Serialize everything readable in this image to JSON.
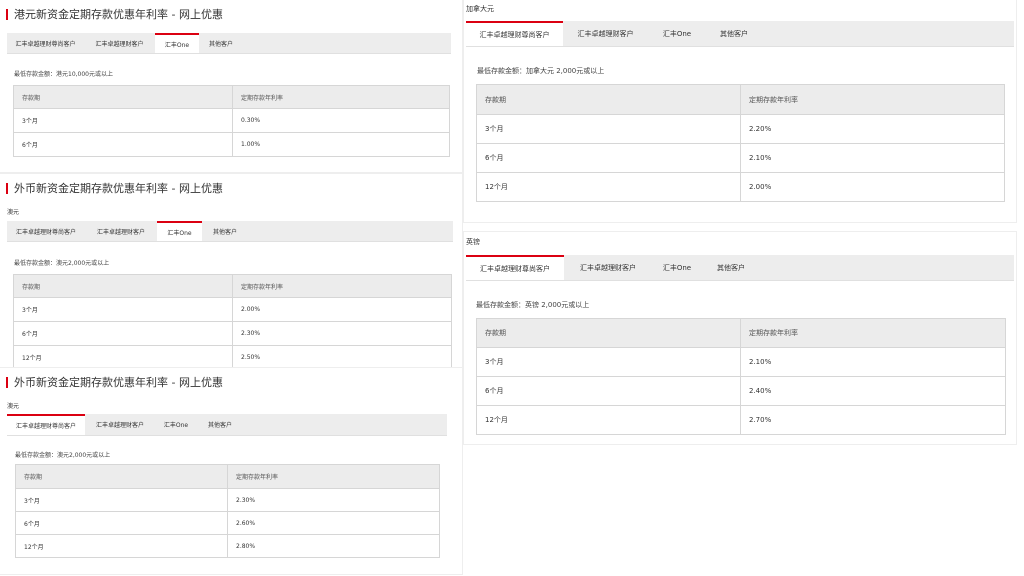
{
  "common": {
    "tabs": [
      "汇丰卓越理财尊尚客户",
      "汇丰卓越理财客户",
      "汇丰One",
      "其他客户"
    ],
    "col_period": "存款期",
    "col_rate": "定期存款年利率"
  },
  "hkd": {
    "title": "港元新资金定期存款优惠年利率 - 网上优惠",
    "min": "最低存款金额：港元10,000元或以上",
    "rows": [
      [
        "3个月",
        "0.30%"
      ],
      [
        "6个月",
        "1.00%"
      ]
    ]
  },
  "aud1": {
    "title": "外币新资金定期存款优惠年利率 - 网上优惠",
    "currency": "澳元",
    "min": "最低存款金额：澳元2,000元或以上",
    "rows": [
      [
        "3个月",
        "2.00%"
      ],
      [
        "6个月",
        "2.30%"
      ],
      [
        "12个月",
        "2.50%"
      ]
    ]
  },
  "aud2": {
    "title": "外币新资金定期存款优惠年利率 - 网上优惠",
    "currency": "澳元",
    "min": "最低存款金额：澳元2,000元或以上",
    "rows": [
      [
        "3个月",
        "2.30%"
      ],
      [
        "6个月",
        "2.60%"
      ],
      [
        "12个月",
        "2.80%"
      ]
    ]
  },
  "cad": {
    "currency": "加拿大元",
    "min": "最低存款金额：加拿大元 2,000元或以上",
    "rows": [
      [
        "3个月",
        "2.20%"
      ],
      [
        "6个月",
        "2.10%"
      ],
      [
        "12个月",
        "2.00%"
      ]
    ]
  },
  "gbp": {
    "currency": "英镑",
    "min": "最低存款金额：英镑 2,000元或以上",
    "rows": [
      [
        "3个月",
        "2.10%"
      ],
      [
        "6个月",
        "2.40%"
      ],
      [
        "12个月",
        "2.70%"
      ]
    ]
  }
}
